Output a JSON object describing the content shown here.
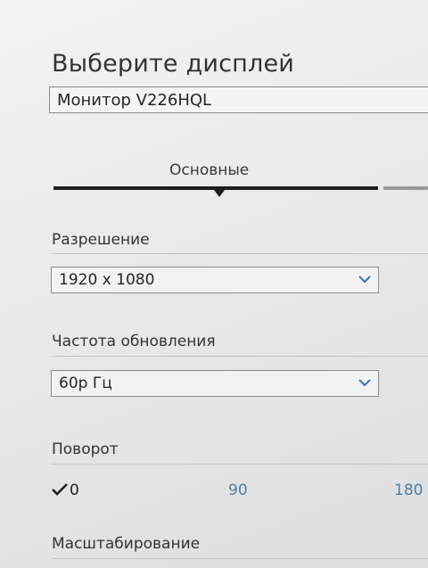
{
  "page": {
    "title": "Выберите дисплей"
  },
  "display_select": {
    "value": "Монитор V226HQL"
  },
  "tabs": {
    "active_label": "Основные"
  },
  "resolution": {
    "label": "Разрешение",
    "value": "1920 x 1080"
  },
  "refresh_rate": {
    "label": "Частота обновления",
    "value": "60р Гц"
  },
  "rotation": {
    "label": "Поворот",
    "options": [
      "0",
      "90",
      "180"
    ],
    "selected": "0"
  },
  "scaling": {
    "label": "Масштабирование"
  },
  "icons": {
    "dropdown": "chevron-down-icon",
    "selected": "check-icon"
  },
  "colors": {
    "accent": "#4a7fa8",
    "text": "#333333",
    "background": "#ececec"
  }
}
